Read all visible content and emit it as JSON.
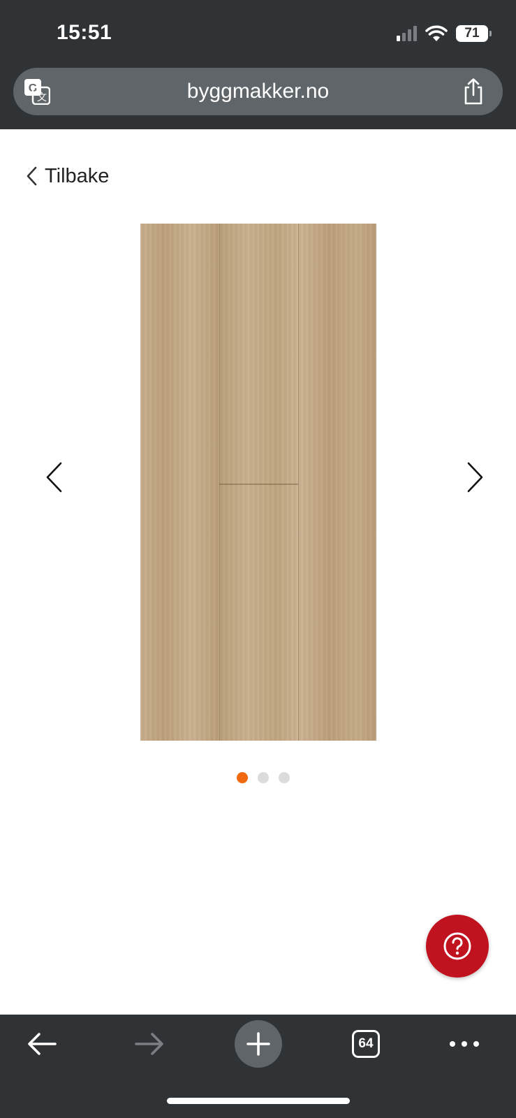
{
  "status_bar": {
    "time": "15:51",
    "battery": "71"
  },
  "browser": {
    "url": "byggmakker.no"
  },
  "page": {
    "back_label": "Tilbake",
    "carousel": {
      "image": "wood-floor-plank-sample",
      "total_images": 3,
      "active_index": 0
    },
    "help_icon": "question-icon"
  },
  "toolbar": {
    "tabs_count": "64"
  },
  "colors": {
    "chrome": "#303336",
    "url_bar": "#5f6569",
    "accent_dot": "#f26a10",
    "help_button": "#c1121f"
  }
}
